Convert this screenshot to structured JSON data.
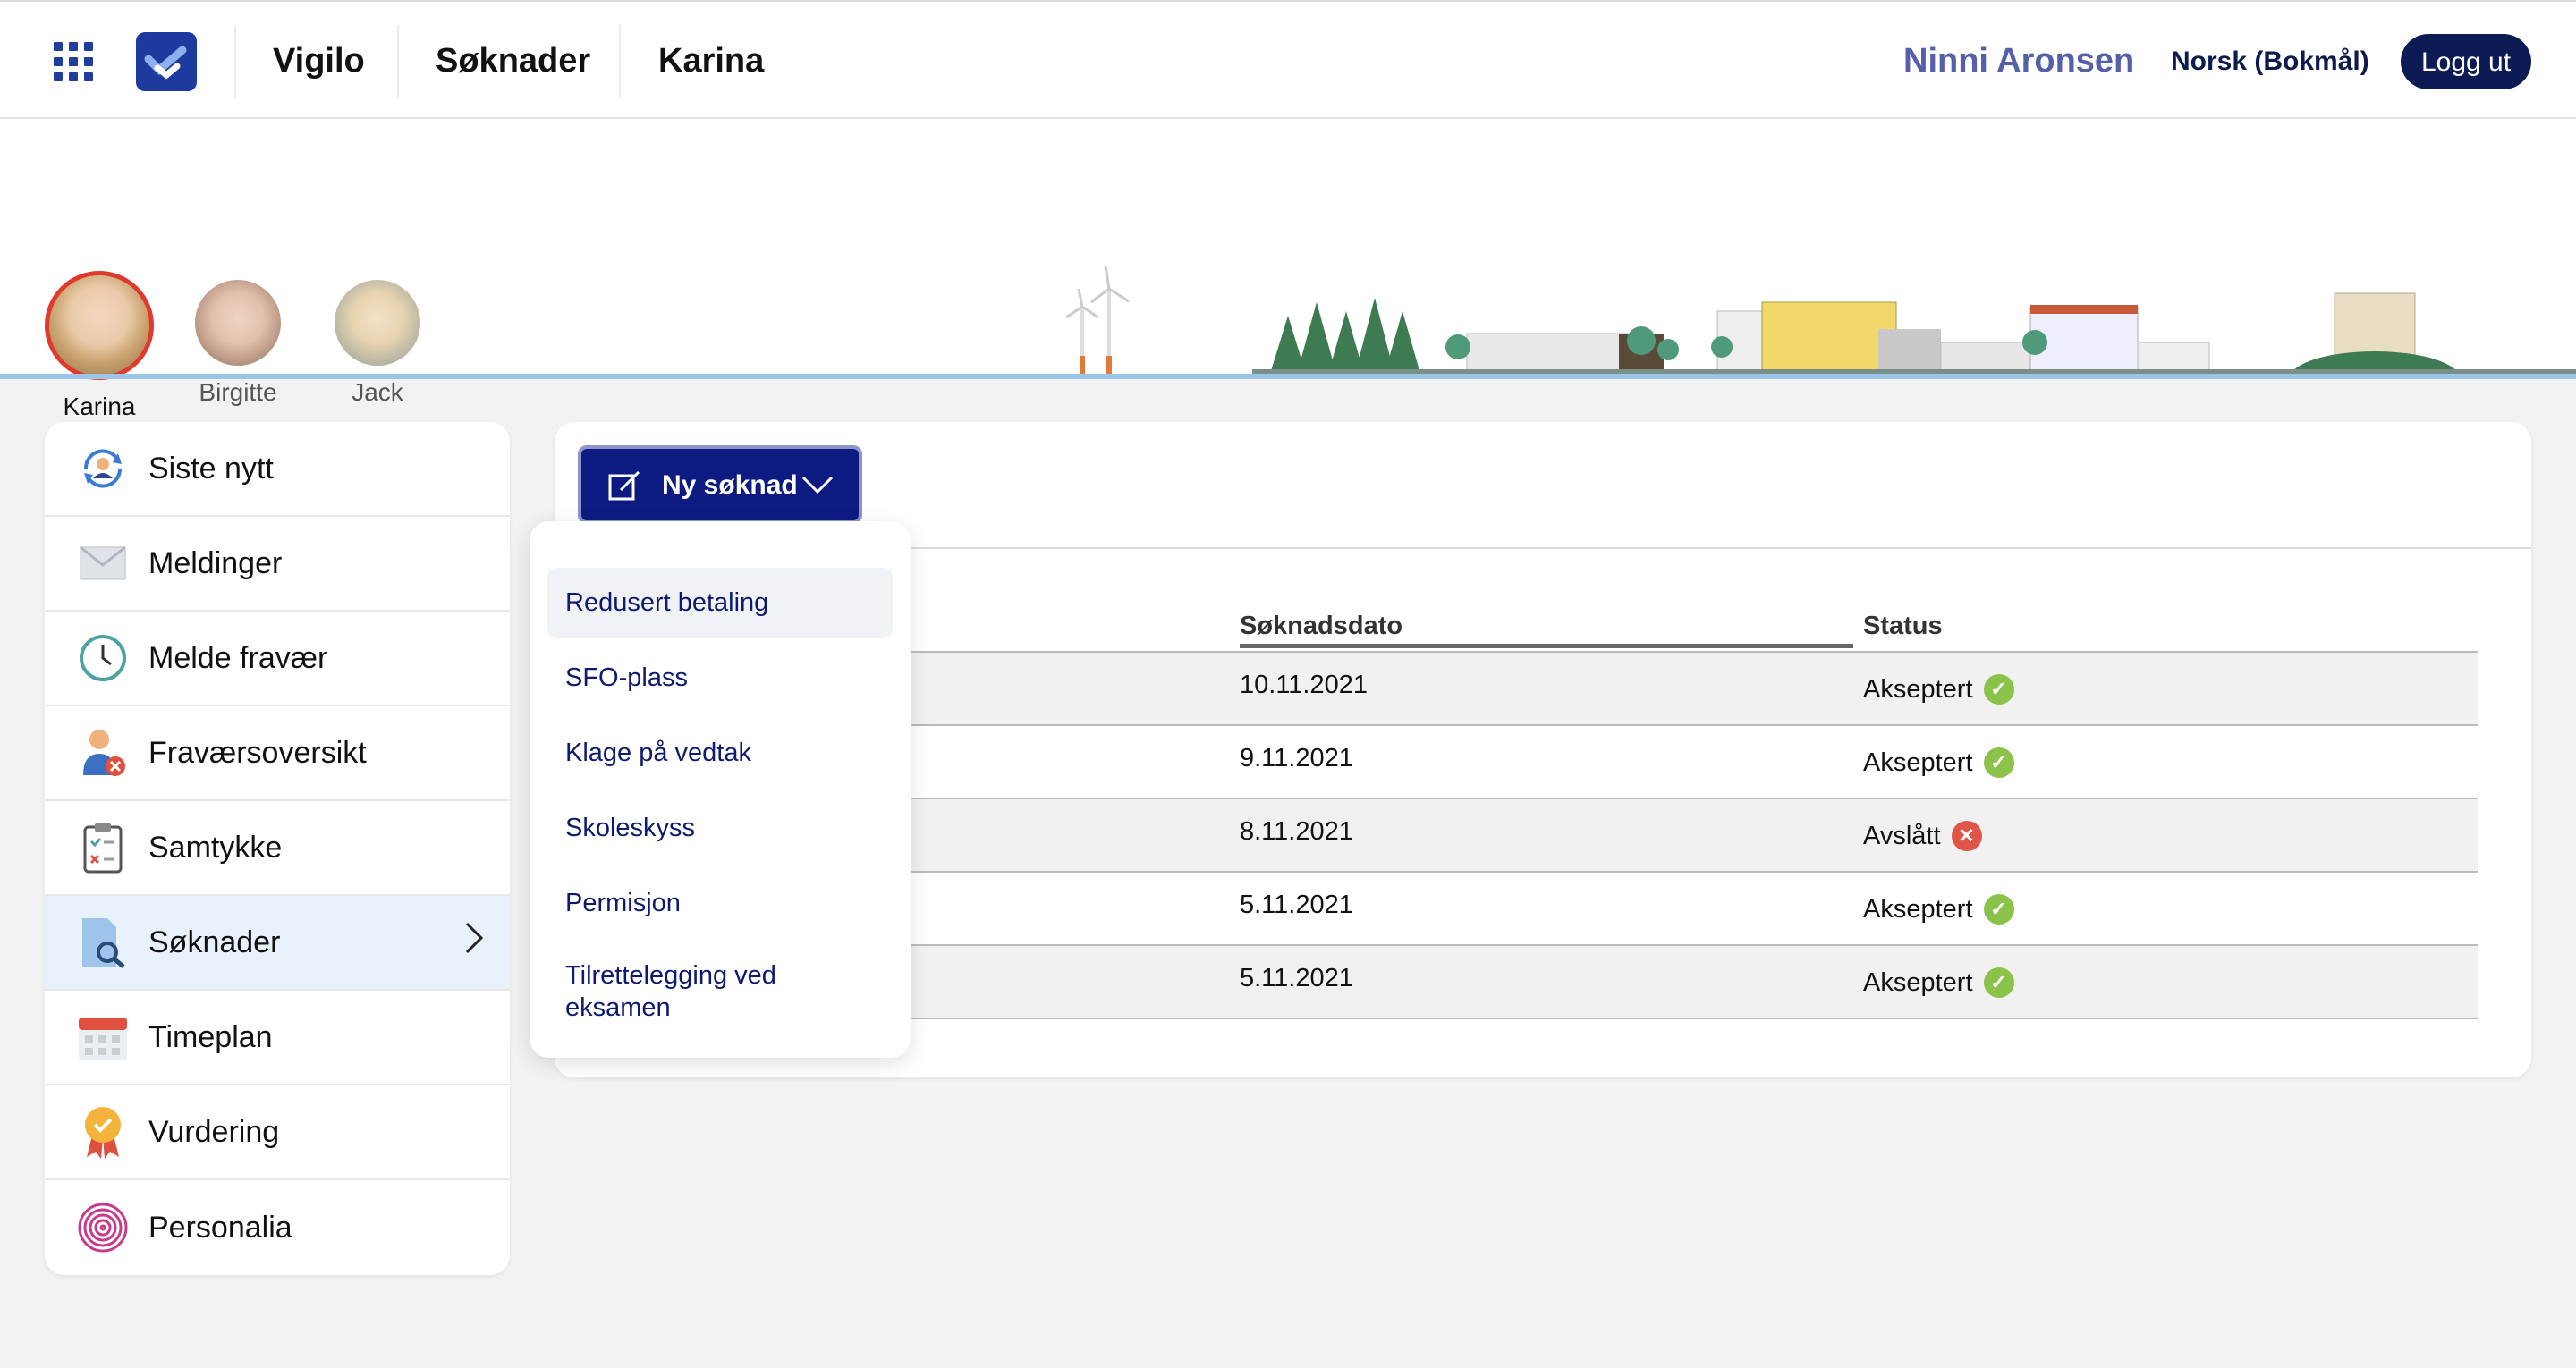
{
  "header": {
    "nav": [
      "Vigilo",
      "Søknader",
      "Karina"
    ],
    "user_name": "Ninni Aronsen",
    "language": "Norsk (Bokmål)",
    "logout_label": "Logg ut"
  },
  "children": [
    {
      "name": "Karina",
      "active": true
    },
    {
      "name": "Birgitte",
      "active": false
    },
    {
      "name": "Jack",
      "active": false
    }
  ],
  "sidebar": {
    "items": [
      {
        "label": "Siste nytt",
        "icon": "refresh-person-icon"
      },
      {
        "label": "Meldinger",
        "icon": "envelope-icon"
      },
      {
        "label": "Melde fravær",
        "icon": "clock-icon"
      },
      {
        "label": "Fraværsoversikt",
        "icon": "person-absent-icon"
      },
      {
        "label": "Samtykke",
        "icon": "clipboard-check-icon"
      },
      {
        "label": "Søknader",
        "icon": "document-search-icon",
        "active": true
      },
      {
        "label": "Timeplan",
        "icon": "calendar-icon"
      },
      {
        "label": "Vurdering",
        "icon": "award-badge-icon"
      },
      {
        "label": "Personalia",
        "icon": "fingerprint-icon"
      }
    ]
  },
  "main": {
    "new_button_label": "Ny søknad",
    "table": {
      "headers": [
        "Søknadsdato",
        "Status"
      ],
      "rows": [
        {
          "date": "10.11.2021",
          "status": "Akseptert",
          "state": "ok"
        },
        {
          "date": "9.11.2021",
          "status": "Akseptert",
          "state": "ok"
        },
        {
          "date": "8.11.2021",
          "status": "Avslått",
          "state": "rejected"
        },
        {
          "date": "5.11.2021",
          "status": "Akseptert",
          "state": "ok"
        },
        {
          "date": "5.11.2021",
          "status": "Akseptert",
          "state": "ok"
        }
      ]
    },
    "dropdown": {
      "items": [
        "Redusert betaling",
        "SFO-plass",
        "Klage på vedtak",
        "Skoleskyss",
        "Permisjon",
        "Tilrettelegging ved eksamen"
      ]
    }
  },
  "colors": {
    "brand": "#1d3a9e",
    "button": "#0d1a82",
    "accepted": "#8bc34a",
    "rejected": "#e05548"
  }
}
